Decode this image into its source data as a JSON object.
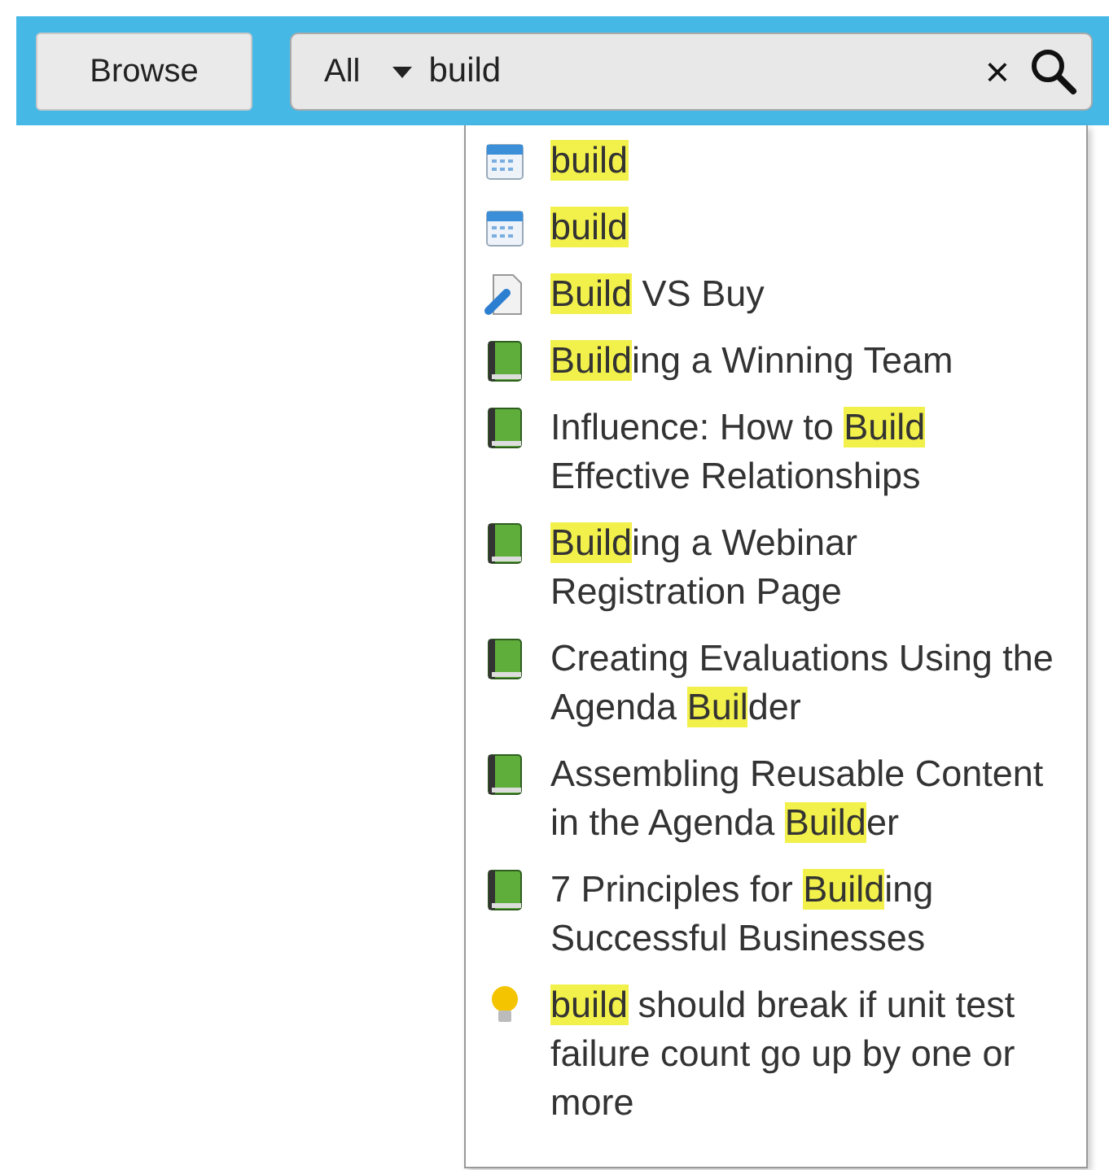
{
  "toolbar": {
    "browse_button": "Browse",
    "search": {
      "scope": "All",
      "value": "build",
      "clear_label": "×"
    }
  },
  "results": [
    {
      "kind": "calendar",
      "segments": [
        {
          "text": "build",
          "highlighted": true
        }
      ]
    },
    {
      "kind": "calendar",
      "segments": [
        {
          "text": "build",
          "highlighted": true
        }
      ]
    },
    {
      "kind": "attachment",
      "segments": [
        {
          "text": "Build",
          "highlighted": true
        },
        {
          "text": " VS Buy",
          "highlighted": false
        }
      ]
    },
    {
      "kind": "book",
      "segments": [
        {
          "text": "Build",
          "highlighted": true
        },
        {
          "text": "ing a Winning Team",
          "highlighted": false
        }
      ]
    },
    {
      "kind": "book",
      "segments": [
        {
          "text": "Influence: How to ",
          "highlighted": false
        },
        {
          "text": "Build",
          "highlighted": true
        },
        {
          "text": " Effective Relationships",
          "highlighted": false
        }
      ]
    },
    {
      "kind": "book",
      "segments": [
        {
          "text": "Build",
          "highlighted": true
        },
        {
          "text": "ing a Webinar Registration Page",
          "highlighted": false
        }
      ]
    },
    {
      "kind": "book",
      "segments": [
        {
          "text": "Creating Evaluations Using the Agenda ",
          "highlighted": false
        },
        {
          "text": "Buil",
          "highlighted": true
        },
        {
          "text": "der",
          "highlighted": false
        }
      ]
    },
    {
      "kind": "book",
      "segments": [
        {
          "text": "Assembling Reusable Content in the Agenda ",
          "highlighted": false
        },
        {
          "text": "Build",
          "highlighted": true
        },
        {
          "text": "er",
          "highlighted": false
        }
      ]
    },
    {
      "kind": "book",
      "segments": [
        {
          "text": "7 Principles for ",
          "highlighted": false
        },
        {
          "text": "Build",
          "highlighted": true
        },
        {
          "text": "ing Successful Businesses",
          "highlighted": false
        }
      ]
    },
    {
      "kind": "idea",
      "segments": [
        {
          "text": "build",
          "highlighted": true
        },
        {
          "text": " should break if unit test failure count go up by one or more",
          "highlighted": false
        }
      ]
    }
  ]
}
